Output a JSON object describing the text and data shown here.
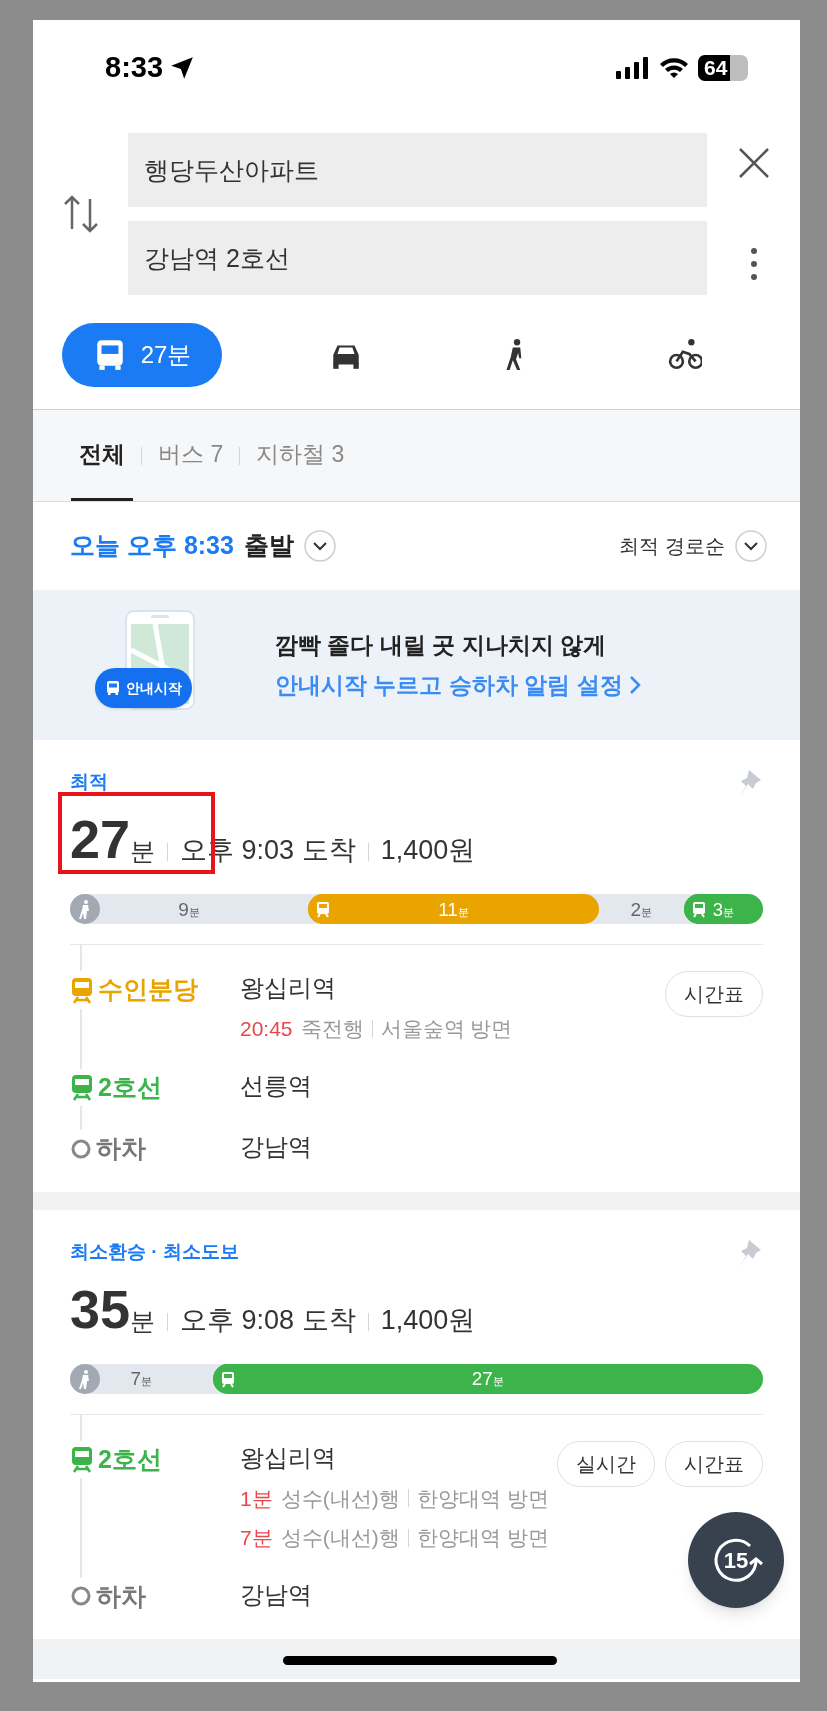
{
  "status_bar": {
    "time": "8:33",
    "battery": "64"
  },
  "search": {
    "origin": "행당두산아파트",
    "destination": "강남역 2호선"
  },
  "modes": [
    {
      "kind": "bus",
      "label": "27분",
      "selected": true
    },
    {
      "kind": "car",
      "selected": false
    },
    {
      "kind": "walk",
      "selected": false
    },
    {
      "kind": "bike",
      "selected": false
    }
  ],
  "tabs": [
    {
      "label": "전체",
      "selected": true
    },
    {
      "label": "버스 7",
      "selected": false
    },
    {
      "label": "지하철 3",
      "selected": false
    }
  ],
  "departure": {
    "time": "오늘 오후 8:33",
    "suffix": "출발",
    "sort": "최적 경로순"
  },
  "banner": {
    "badge": "안내시작",
    "title": "깜빡 졸다 내릴 곳 지나치지 않게",
    "link": "안내시작 누르고 승하차 알림 설정"
  },
  "routes": [
    {
      "label": "최적",
      "minutes": "27",
      "unit": "분",
      "arrival": "오후 9:03 도착",
      "fare": "1,400원",
      "highlighted": true,
      "segments": [
        {
          "kind": "walk",
          "minutes": "9",
          "unit": "분"
        },
        {
          "kind": "transit",
          "color": "#e9a400",
          "minutes": "11",
          "unit": "분"
        },
        {
          "kind": "gap",
          "minutes": "2",
          "unit": "분"
        },
        {
          "kind": "transit",
          "color": "#3cb44a",
          "minutes": "3",
          "unit": "분"
        }
      ],
      "steps": [
        {
          "kind": "transit",
          "color": "#e9a400",
          "line": "수인분당",
          "station": "왕십리역",
          "buttons": [
            "시간표"
          ],
          "arrivals": [
            {
              "time": "20:45",
              "dest": "죽전행",
              "direction": "서울숲역 방면"
            }
          ]
        },
        {
          "kind": "transit",
          "color": "#3cb44a",
          "line": "2호선",
          "station": "선릉역"
        },
        {
          "kind": "alight",
          "line": "하차",
          "station": "강남역"
        }
      ]
    },
    {
      "label": "최소환승 · 최소도보",
      "minutes": "35",
      "unit": "분",
      "arrival": "오후 9:08 도착",
      "fare": "1,400원",
      "highlighted": false,
      "segments": [
        {
          "kind": "walk",
          "minutes": "7",
          "unit": "분"
        },
        {
          "kind": "transit",
          "color": "#3cb44a",
          "minutes": "27",
          "unit": "분"
        }
      ],
      "steps": [
        {
          "kind": "transit",
          "color": "#3cb44a",
          "line": "2호선",
          "station": "왕십리역",
          "buttons": [
            "실시간",
            "시간표"
          ],
          "arrivals": [
            {
              "time": "1분",
              "dest": "성수(내선)행",
              "direction": "한양대역 방면"
            },
            {
              "time": "7분",
              "dest": "성수(내선)행",
              "direction": "한양대역 방면"
            }
          ]
        },
        {
          "kind": "alight",
          "line": "하차",
          "station": "강남역"
        }
      ]
    }
  ],
  "refresh_button": {
    "label": "15"
  }
}
